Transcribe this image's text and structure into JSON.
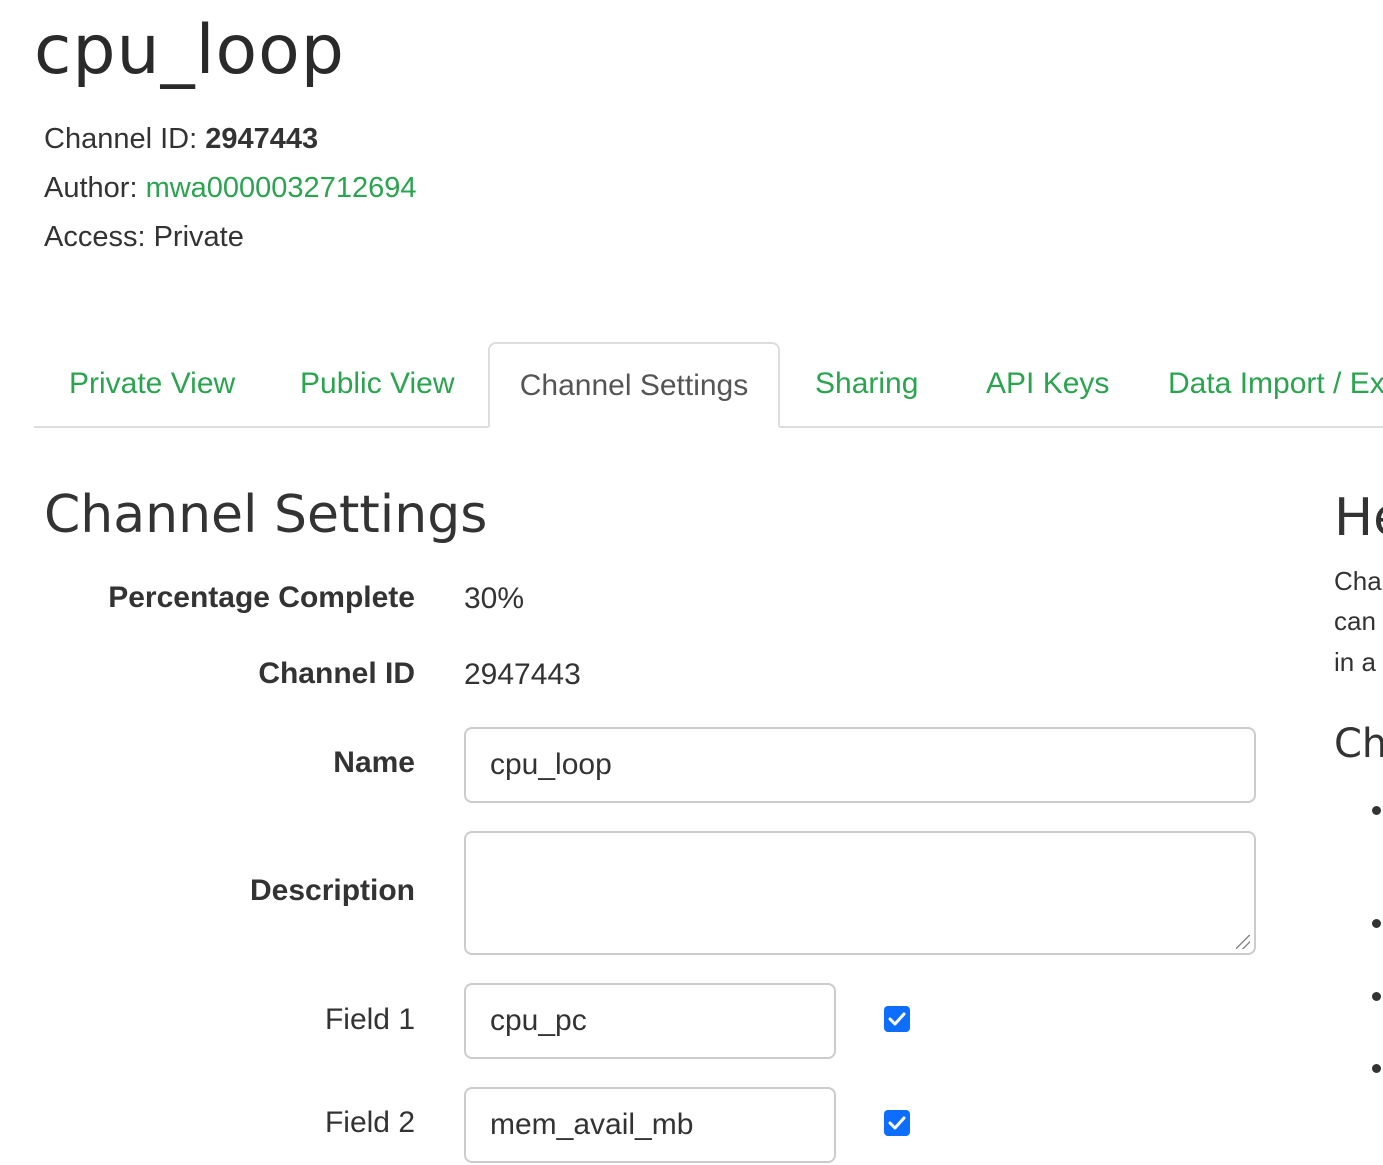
{
  "header": {
    "title": "cpu_loop",
    "channel_id_label": "Channel ID:",
    "channel_id_value": "2947443",
    "author_label": "Author:",
    "author_value": "mwa0000032712694",
    "access_label": "Access:",
    "access_value": "Private"
  },
  "tabs": [
    {
      "label": "Private View",
      "active": false
    },
    {
      "label": "Public View",
      "active": false
    },
    {
      "label": "Channel Settings",
      "active": true
    },
    {
      "label": "Sharing",
      "active": false
    },
    {
      "label": "API Keys",
      "active": false
    },
    {
      "label": "Data Import / Ex",
      "active": false
    }
  ],
  "settings": {
    "title": "Channel Settings",
    "percentage_label": "Percentage Complete",
    "percentage_value": "30%",
    "channel_id_label": "Channel ID",
    "channel_id_value": "2947443",
    "name_label": "Name",
    "name_value": "cpu_loop",
    "description_label": "Description",
    "description_value": "",
    "fields": [
      {
        "label": "Field 1",
        "value": "cpu_pc",
        "checked": true
      },
      {
        "label": "Field 2",
        "value": "mem_avail_mb",
        "checked": true
      }
    ]
  },
  "help": {
    "title": "He",
    "lines": [
      "Cha",
      "can",
      "in a"
    ],
    "subtitle": "Ch"
  },
  "colors": {
    "link": "#2aa44f",
    "checkbox": "#0d6efd"
  }
}
